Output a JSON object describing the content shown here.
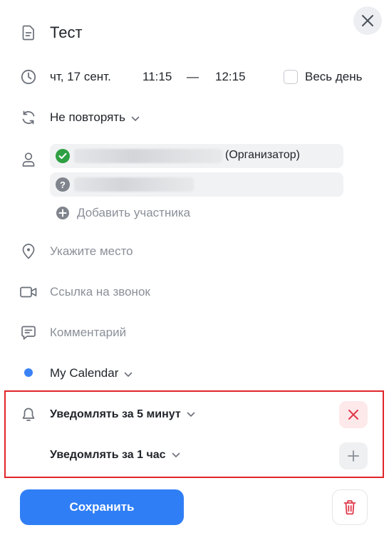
{
  "event": {
    "title": "Тест",
    "date": "чт, 17 сент.",
    "time_start": "11:15",
    "time_dash": "—",
    "time_end": "12:15",
    "all_day_label": "Весь день",
    "all_day_checked": false,
    "repeat_label": "Не повторять"
  },
  "participants": {
    "items": [
      {
        "name_suffix": "(Организатор)",
        "status": "accepted"
      },
      {
        "name_suffix": "",
        "status": "unknown"
      }
    ],
    "status_icons": {
      "accepted": "check",
      "unknown": "?"
    },
    "add_label": "Добавить участника"
  },
  "location_placeholder": "Укажите место",
  "call_link_placeholder": "Ссылка на звонок",
  "comment_placeholder": "Комментарий",
  "calendar": {
    "name": "My Calendar",
    "color": "#3b82f6"
  },
  "notifications": [
    {
      "label": "Уведомлять за 5 минут",
      "action": "remove"
    },
    {
      "label": "Уведомлять за 1 час",
      "action": "add"
    }
  ],
  "footer": {
    "save_label": "Сохранить"
  },
  "colors": {
    "accent": "#2f7ef5",
    "success": "#2ea043",
    "danger": "#e0394a",
    "danger_bg": "#fde8ea",
    "muted_text": "#8a8f98",
    "highlight_border": "#e0252a"
  }
}
